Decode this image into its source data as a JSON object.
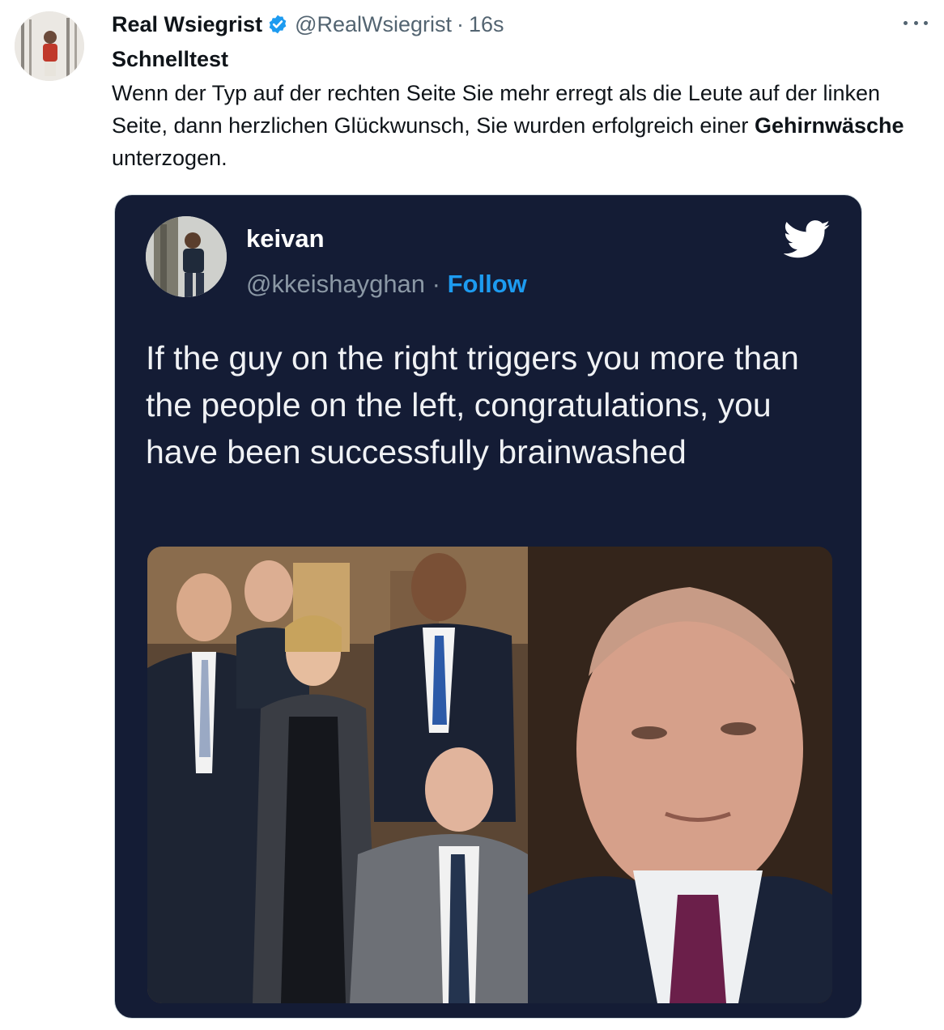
{
  "tweet": {
    "display_name": "Real Wsiegrist",
    "handle": "@RealWsiegrist",
    "separator": "·",
    "time": "16s",
    "title": "Schnelltest",
    "text_before": "Wenn der Typ auf der rechten Seite Sie mehr erregt als die Leute auf der linken Seite, dann herzlichen Glückwunsch, Sie wurden erfolgreich einer ",
    "text_bold": "Gehirnwäsche",
    "text_after": " unterzogen."
  },
  "embedded": {
    "name": "keivan",
    "handle": "@kkeishayghan",
    "separator": "·",
    "follow_label": "Follow",
    "text": "If the guy on the right triggers you more than the people on the left, congratulations, you have been successfully brainwashed"
  },
  "colors": {
    "verified_blue": "#1d9bf0",
    "card_background": "#141c35",
    "follow_blue": "#1d9bf0",
    "muted_text": "#536471"
  },
  "icons": [
    "verified-badge-icon",
    "more-options-icon",
    "twitter-bird-icon"
  ]
}
